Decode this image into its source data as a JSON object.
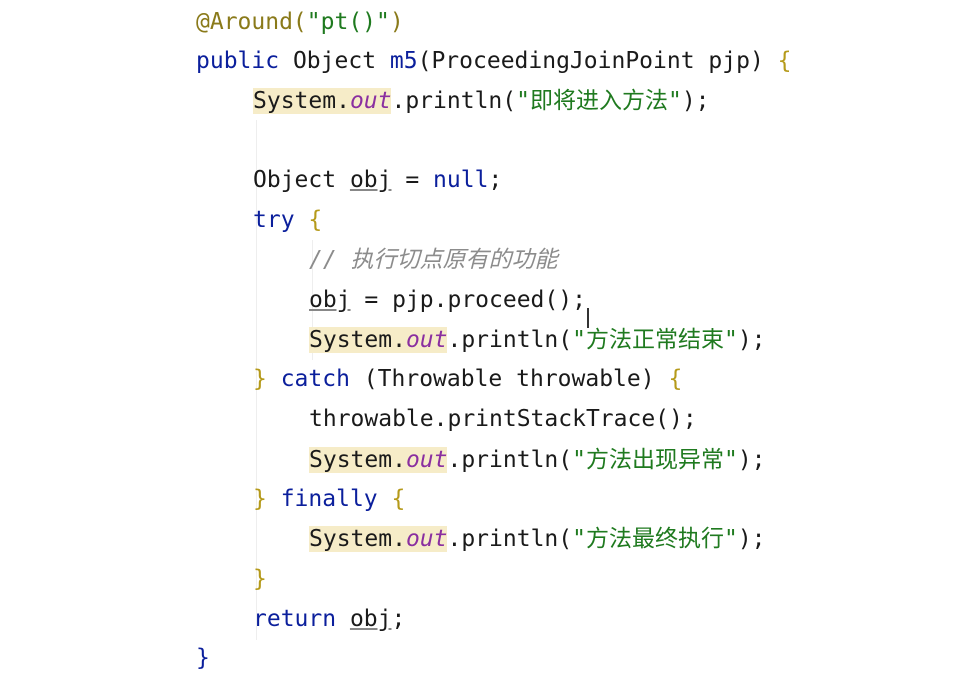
{
  "code": {
    "annotation": {
      "at": "@Around(",
      "arg": "\"pt()\"",
      "close": ")"
    },
    "signature": {
      "modifier": "public",
      "type": "Object",
      "name": "m5",
      "params": "(ProceedingJoinPoint pjp) ",
      "open": "{"
    },
    "print1": {
      "sys": "System.",
      "out": "out",
      "call": ".println(",
      "str": "\"即将进入方法\"",
      "end": ");"
    },
    "decl": {
      "type": "Object ",
      "var": "obj",
      "op": " = ",
      "kw": "null",
      "end": ";"
    },
    "try_open": {
      "kw": "try",
      "open": " {"
    },
    "comment": "// 执行切点原有的功能",
    "proceed": {
      "var": "obj",
      "expr": " = pjp.proceed();"
    },
    "print2": {
      "sys": "System.",
      "out": "out",
      "call": ".println(",
      "str": "\"方法正常结束\"",
      "end": ");"
    },
    "catch_line": {
      "close": "} ",
      "kw": "catch",
      "params": " (Throwable throwable) ",
      "open": "{"
    },
    "stack": "throwable.printStackTrace();",
    "print3": {
      "sys": "System.",
      "out": "out",
      "call": ".println(",
      "str": "\"方法出现异常\"",
      "end": ");"
    },
    "finally_line": {
      "close": "} ",
      "kw": "finally",
      "open": " {"
    },
    "print4": {
      "sys": "System.",
      "out": "out",
      "call": ".println(",
      "str": "\"方法最终执行\"",
      "end": ");"
    },
    "finally_close": "}",
    "return_line": {
      "kw": "return",
      "sp": " ",
      "var": "obj",
      "end": ";"
    },
    "method_close": "}"
  }
}
